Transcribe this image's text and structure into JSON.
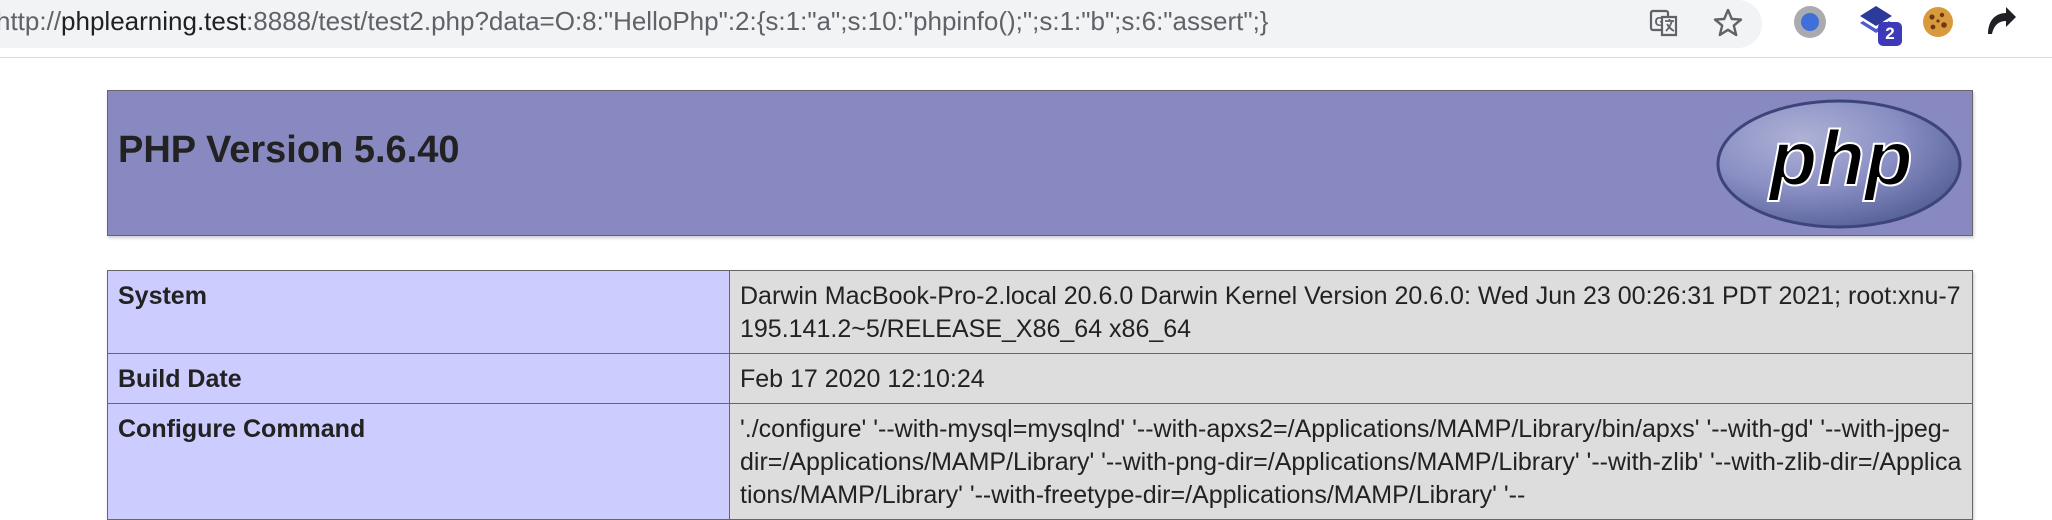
{
  "browser": {
    "url_prefix": "http://",
    "url_host": "phplearning.test",
    "url_rest": ":8888/test/test2.php?data=O:8:\"HelloPhp\":2:{s:1:\"a\";s:10:\"phpinfo();\";s:1:\"b\";s:6:\"assert\";}",
    "icons": [
      "translate-icon",
      "star-icon",
      "extension-circle-icon",
      "extension-layers-icon",
      "cookie-icon",
      "extension-arrow-icon"
    ],
    "extension_badge": "2"
  },
  "phpinfo": {
    "title": "PHP Version 5.6.40",
    "logo_text": "php",
    "rows": [
      {
        "label": "System",
        "value": "Darwin MacBook-Pro-2.local 20.6.0 Darwin Kernel Version 20.6.0: Wed Jun 23 00:26:31 PDT 2021; root:xnu-7195.141.2~5/RELEASE_X86_64 x86_64"
      },
      {
        "label": "Build Date",
        "value": "Feb 17 2020 12:10:24"
      },
      {
        "label": "Configure Command",
        "value": "'./configure' '--with-mysql=mysqlnd' '--with-apxs2=/Applications/MAMP/Library/bin/apxs' '--with-gd' '--with-jpeg-dir=/Applications/MAMP/Library' '--with-png-dir=/Applications/MAMP/Library' '--with-zlib' '--with-zlib-dir=/Applications/MAMP/Library' '--with-freetype-dir=/Applications/MAMP/Library' '--"
      }
    ]
  },
  "colors": {
    "header_bg": "#8889c0",
    "label_bg": "#ccccff",
    "value_bg": "#dddddd"
  }
}
